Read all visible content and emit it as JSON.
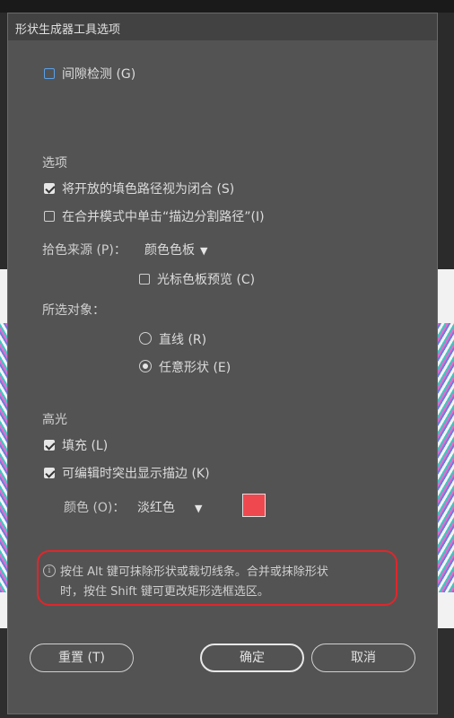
{
  "dialog": {
    "title": "形状生成器工具选项"
  },
  "gap_detection": {
    "label": "间隙检测 (G)",
    "checked": false
  },
  "options": {
    "heading": "选项",
    "treat_open_fill_paths": {
      "label": "将开放的填色路径视为闭合 (S)",
      "checked": true
    },
    "click_stroke_split": {
      "label": "在合并模式中单击“描边分割路径”(I)",
      "checked": false
    },
    "pick_color_from": {
      "label": "拾色来源 (P)：",
      "value": "颜色色板"
    },
    "cursor_swatch_preview": {
      "label": "光标色板预览 (C)",
      "checked": false
    }
  },
  "selection": {
    "heading": "所选对象：",
    "straight": {
      "label": "直线 (R)",
      "selected": false
    },
    "freeform": {
      "label": "任意形状 (E)",
      "selected": true
    }
  },
  "highlight": {
    "heading": "高光",
    "fill": {
      "label": "填充 (L)",
      "checked": true
    },
    "highlight_stroke": {
      "label": "可编辑时突出显示描边 (K)",
      "checked": true
    },
    "color": {
      "label": "颜色 (O)：",
      "value": "淡红色",
      "swatch": "#f0484f"
    }
  },
  "info": {
    "line1": "按住 Alt 键可抹除形状或裁切线条。合并或抹除形状",
    "line2": "时，按住 Shift 键可更改矩形选框选区。"
  },
  "buttons": {
    "reset": "重置 (T)",
    "ok": "确定",
    "cancel": "取消"
  }
}
